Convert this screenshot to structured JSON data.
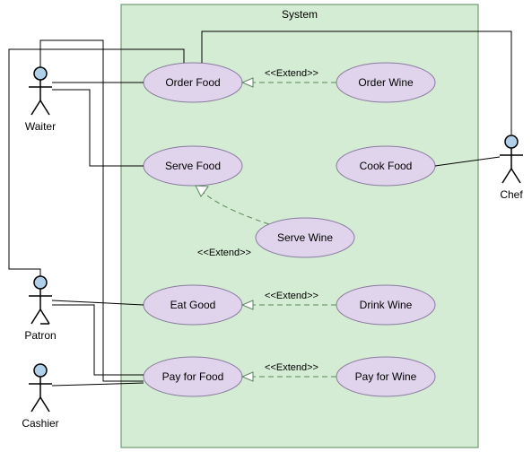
{
  "system": {
    "label": "System"
  },
  "actors": {
    "waiter": {
      "label": "Waiter"
    },
    "patron": {
      "label": "Patron"
    },
    "cashier": {
      "label": "Cashier"
    },
    "chef": {
      "label": "Chef"
    }
  },
  "usecases": {
    "orderFood": {
      "label": "Order Food"
    },
    "orderWine": {
      "label": "Order Wine"
    },
    "serveFood": {
      "label": "Serve Food"
    },
    "cookFood": {
      "label": "Cook Food"
    },
    "serveWine": {
      "label": "Serve Wine"
    },
    "eatGood": {
      "label": "Eat Good"
    },
    "drinkWine": {
      "label": "Drink Wine"
    },
    "payForFood": {
      "label": "Pay for Food"
    },
    "payForWine": {
      "label": "Pay for Wine"
    }
  },
  "stereotypes": {
    "extend": "<<Extend>>"
  },
  "chart_data": {
    "type": "uml-use-case",
    "system": "System",
    "actors": [
      "Waiter",
      "Patron",
      "Cashier",
      "Chef"
    ],
    "usecases": [
      "Order Food",
      "Order Wine",
      "Serve Food",
      "Cook Food",
      "Serve Wine",
      "Eat Good",
      "Drink Wine",
      "Pay for Food",
      "Pay for Wine"
    ],
    "associations": [
      [
        "Waiter",
        "Order Food"
      ],
      [
        "Waiter",
        "Serve Food"
      ],
      [
        "Waiter",
        "Pay for Food"
      ],
      [
        "Patron",
        "Order Food"
      ],
      [
        "Patron",
        "Eat Good"
      ],
      [
        "Patron",
        "Pay for Food"
      ],
      [
        "Cashier",
        "Pay for Food"
      ],
      [
        "Chef",
        "Order Food"
      ],
      [
        "Chef",
        "Cook Food"
      ]
    ],
    "extends": [
      [
        "Order Wine",
        "Order Food"
      ],
      [
        "Serve Wine",
        "Serve Food"
      ],
      [
        "Drink Wine",
        "Eat Good"
      ],
      [
        "Pay for Wine",
        "Pay for Food"
      ]
    ]
  }
}
